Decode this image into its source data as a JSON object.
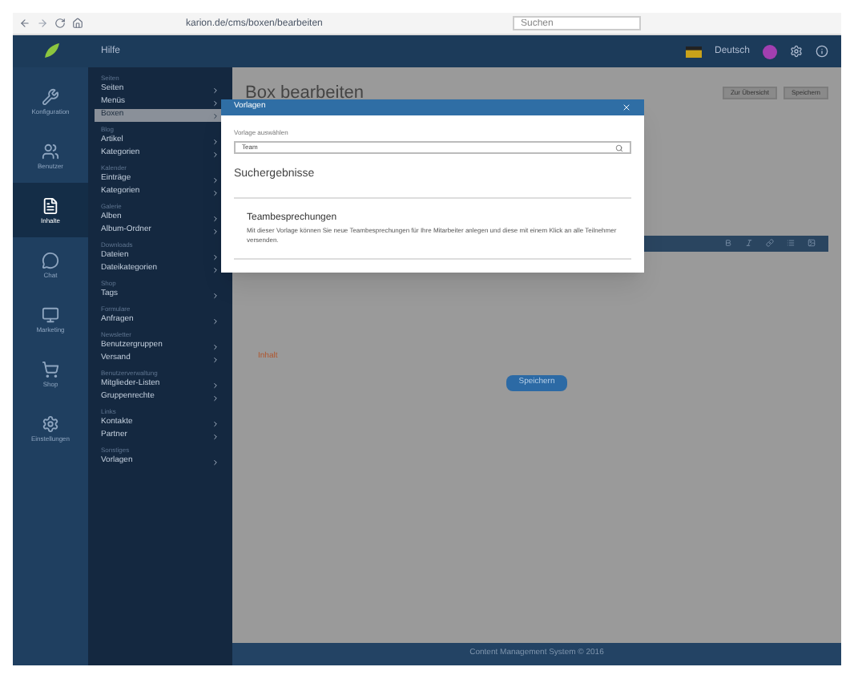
{
  "browser": {
    "url": "karion.de/cms/boxen/bearbeiten",
    "search_placeholder": "Suchen"
  },
  "header": {
    "crumb": "Hilfe",
    "language": "Deutsch"
  },
  "rail": [
    {
      "label": "Konfiguration",
      "kind": "wrench",
      "selected": false
    },
    {
      "label": "Benutzer",
      "kind": "users",
      "selected": false
    },
    {
      "label": "Inhalte",
      "kind": "file",
      "selected": true
    },
    {
      "label": "Chat",
      "kind": "chat",
      "selected": false
    },
    {
      "label": "Marketing",
      "kind": "monitor",
      "selected": false
    },
    {
      "label": "Shop",
      "kind": "cart",
      "selected": false
    },
    {
      "label": "Einstellungen",
      "kind": "gear",
      "selected": false
    }
  ],
  "menu": [
    {
      "heading": "Seiten",
      "items": [
        {
          "label": "Seiten",
          "selected": false
        },
        {
          "label": "Menüs",
          "selected": false
        },
        {
          "label": "Boxen",
          "selected": true
        }
      ]
    },
    {
      "heading": "Blog",
      "items": [
        {
          "label": "Artikel",
          "selected": false
        },
        {
          "label": "Kategorien",
          "selected": false
        }
      ]
    },
    {
      "heading": "Kalender",
      "items": [
        {
          "label": "Einträge",
          "selected": false
        },
        {
          "label": "Kategorien",
          "selected": false
        }
      ]
    },
    {
      "heading": "Galerie",
      "items": [
        {
          "label": "Alben",
          "selected": false
        },
        {
          "label": "Album-Ordner",
          "selected": false
        }
      ]
    },
    {
      "heading": "Downloads",
      "items": [
        {
          "label": "Dateien",
          "selected": false
        },
        {
          "label": "Dateikategorien",
          "selected": false
        }
      ]
    },
    {
      "heading": "Shop",
      "items": [
        {
          "label": "Tags",
          "selected": false
        }
      ]
    },
    {
      "heading": "Formulare",
      "items": [
        {
          "label": "Anfragen",
          "selected": false
        }
      ]
    },
    {
      "heading": "Newsletter",
      "items": [
        {
          "label": "Benutzergruppen",
          "selected": false
        },
        {
          "label": "Versand",
          "selected": false
        }
      ]
    },
    {
      "heading": "Benutzerverwaltung",
      "items": [
        {
          "label": "Mitglieder-Listen",
          "selected": false
        },
        {
          "label": "Gruppenrechte",
          "selected": false
        }
      ]
    },
    {
      "heading": "Links",
      "items": [
        {
          "label": "Kontakte",
          "selected": false
        },
        {
          "label": "Partner",
          "selected": false
        }
      ]
    },
    {
      "heading": "Sonstiges",
      "items": [
        {
          "label": "Vorlagen",
          "selected": false
        }
      ]
    }
  ],
  "page": {
    "title": "Box bearbeiten",
    "actions": [
      "Zur Übersicht",
      "Speichern"
    ],
    "note": "Inhalt",
    "save_button": "Speichern",
    "footer": "Content Management System © 2016"
  },
  "modal": {
    "title": "Vorlagen",
    "field_label": "Vorlage auswählen",
    "field_value": "Team",
    "results_heading": "Suchergebnisse",
    "results": [
      {
        "title": "Teambesprechungen",
        "description": "Mit dieser Vorlage können Sie neue Teambesprechungen für Ihre Mitarbeiter anlegen und diese mit einem Klick an alle Teilnehmer versenden."
      }
    ]
  }
}
